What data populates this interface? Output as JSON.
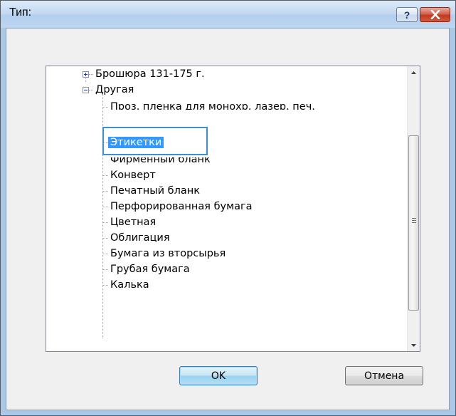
{
  "window": {
    "title": "Тип:",
    "help_button": "?"
  },
  "tree": {
    "items": [
      {
        "label": "Брошюра 131-175 г.",
        "expander": "plus"
      },
      {
        "label": "Другая",
        "expander": "minus"
      },
      {
        "label": "Проз. пленка для монохр. лазер. печ."
      },
      {
        "label": "Этикетки",
        "selected": true
      },
      {
        "label": "Фирменный бланк"
      },
      {
        "label": "Конверт"
      },
      {
        "label": "Печатный бланк"
      },
      {
        "label": "Перфорированная бумага"
      },
      {
        "label": "Цветная"
      },
      {
        "label": "Облигация"
      },
      {
        "label": "Бумага из вторсырья"
      },
      {
        "label": "Грубая бумага"
      },
      {
        "label": "Калька"
      }
    ]
  },
  "buttons": {
    "ok": "OK",
    "cancel": "Отмена"
  },
  "colors": {
    "selection_bg": "#3399ff",
    "selection_frame": "#3a8fd8",
    "close_button": "#c13a1f",
    "ok_button": "#98d1ef"
  },
  "icons": {
    "help": "question-mark-icon",
    "close": "close-x-icon",
    "scroll_up": "arrow-up-icon",
    "scroll_down": "arrow-down-icon",
    "scroll_grip": "grip-icon"
  }
}
